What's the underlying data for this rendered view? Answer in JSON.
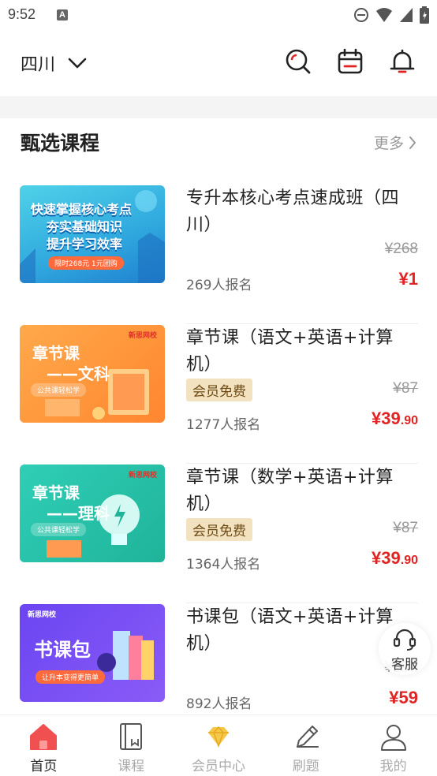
{
  "status_bar": {
    "time": "9:52",
    "notif_letter": "A"
  },
  "header": {
    "city": "四川"
  },
  "section": {
    "title": "甄选课程",
    "more_label": "更多"
  },
  "courses": [
    {
      "title": "专升本核心考点速成班（四川）",
      "badge": "",
      "original_price": "¥268",
      "enrolled": "269人报名",
      "price_main": "¥1",
      "price_decimal": "",
      "thumb": {
        "lines": [
          "快速掌握核心考点",
          "夯实基础知识",
          "提升学习效率"
        ],
        "ribbon": "限时268元 1元团购"
      }
    },
    {
      "title": "章节课（语文+英语+计算机）",
      "badge": "会员免费",
      "original_price": "¥87",
      "enrolled": "1277人报名",
      "price_main": "¥39",
      "price_decimal": ".90",
      "thumb": {
        "brand": "新思网校",
        "line1": "章节课",
        "line2": "——文科",
        "sub": "公共课轻松学"
      }
    },
    {
      "title": "章节课（数学+英语+计算机）",
      "badge": "会员免费",
      "original_price": "¥87",
      "enrolled": "1364人报名",
      "price_main": "¥39",
      "price_decimal": ".90",
      "thumb": {
        "brand": "新思网校",
        "line1": "章节课",
        "line2": "——理科",
        "sub": "公共课轻松学"
      }
    },
    {
      "title": "书课包（语文+英语+计算机）",
      "badge": "",
      "original_price": "¥254",
      "enrolled": "892人报名",
      "price_main": "¥59",
      "price_decimal": "",
      "thumb": {
        "brand": "新思网校",
        "line1": "书课包",
        "sub": "让升本变得更简单"
      }
    }
  ],
  "customer_service": {
    "label": "客服"
  },
  "tabs": [
    {
      "label": "首页",
      "icon": "home-icon"
    },
    {
      "label": "课程",
      "icon": "book-icon"
    },
    {
      "label": "会员中心",
      "icon": "diamond-icon"
    },
    {
      "label": "刷题",
      "icon": "pencil-icon"
    },
    {
      "label": "我的",
      "icon": "person-icon"
    }
  ],
  "colors": {
    "accent": "#e02424",
    "badge_bg": "#f3e2bf",
    "muted": "#999999"
  }
}
